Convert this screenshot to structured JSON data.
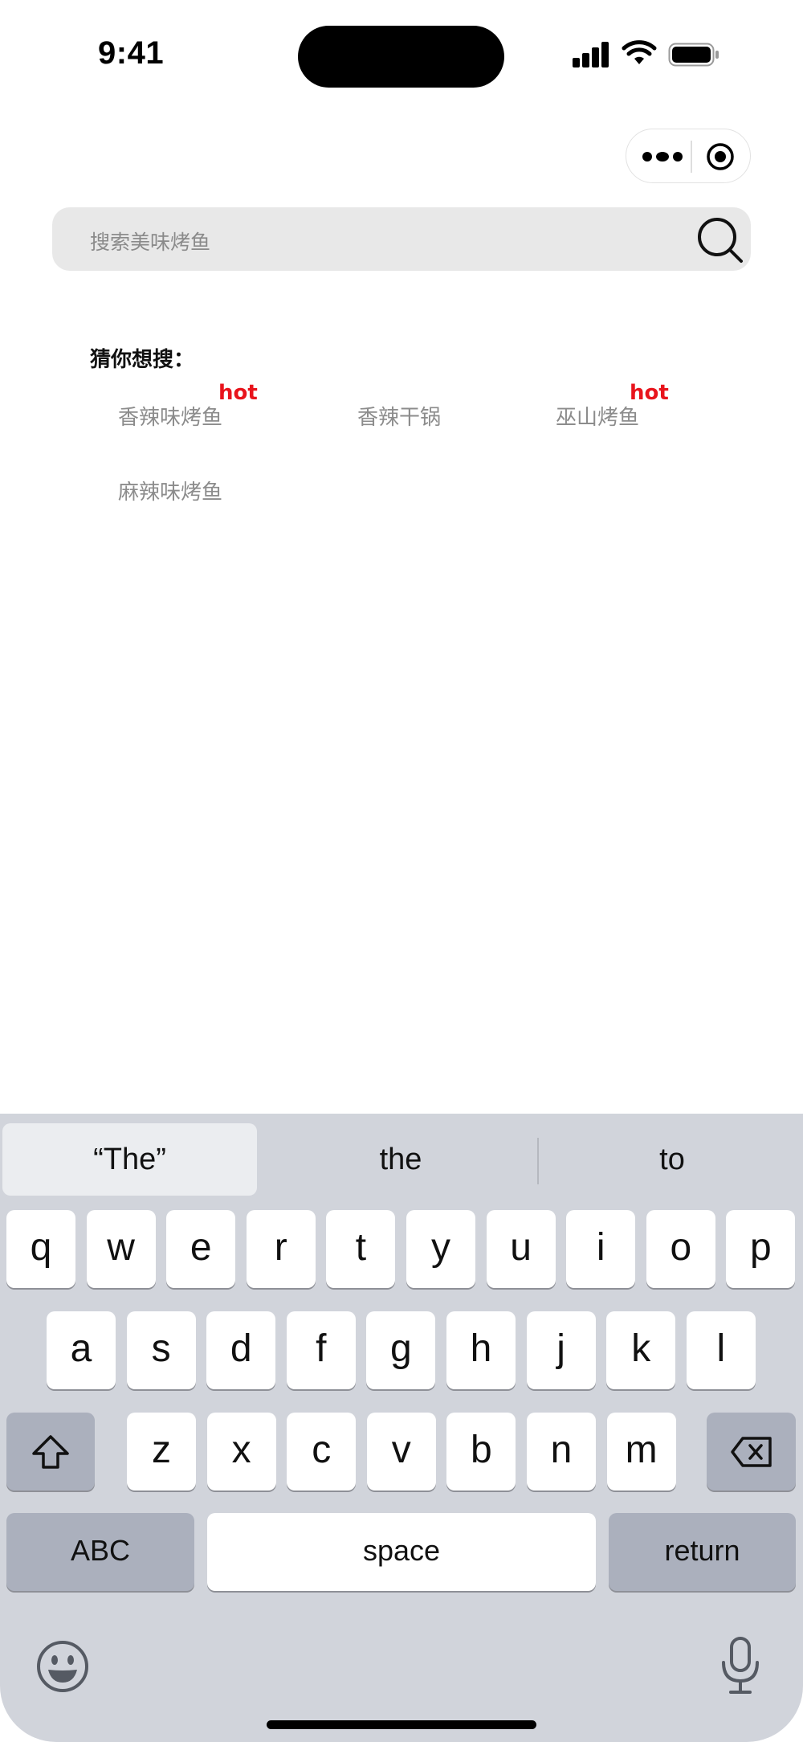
{
  "status_bar": {
    "time": "9:41"
  },
  "search": {
    "placeholder": "搜索美味烤鱼"
  },
  "suggestions": {
    "title": "猜你想搜：",
    "items": [
      {
        "label": "香辣味烤鱼",
        "badge": "hot"
      },
      {
        "label": "香辣干锅"
      },
      {
        "label": "巫山烤鱼",
        "badge": "hot"
      },
      {
        "label": "麻辣味烤鱼"
      }
    ]
  },
  "keyboard": {
    "predictions": [
      "“The”",
      "the",
      "to"
    ],
    "row1": [
      "q",
      "w",
      "e",
      "r",
      "t",
      "y",
      "u",
      "i",
      "o",
      "p"
    ],
    "row2": [
      "a",
      "s",
      "d",
      "f",
      "g",
      "h",
      "j",
      "k",
      "l"
    ],
    "row3": [
      "z",
      "x",
      "c",
      "v",
      "b",
      "n",
      "m"
    ],
    "abc_label": "ABC",
    "space_label": "space",
    "return_label": "return"
  },
  "colors": {
    "hot_badge": "#e8141c",
    "keyboard_bg": "#d1d4db",
    "search_bg": "#e8e8e8"
  }
}
